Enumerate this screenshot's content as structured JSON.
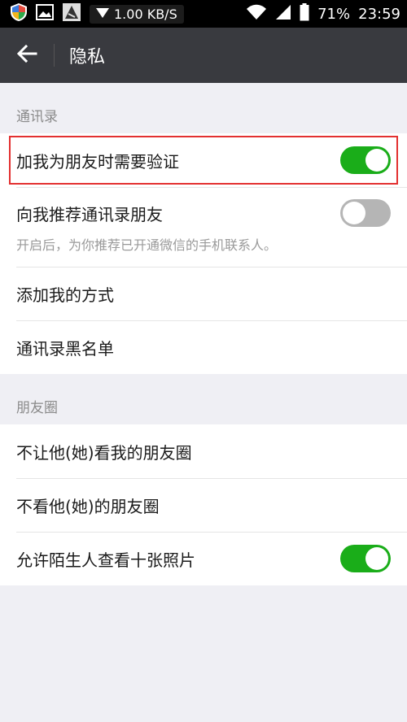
{
  "status_bar": {
    "speed": "1.00 KB/S",
    "battery": "71%",
    "time": "23:59"
  },
  "app_bar": {
    "title": "隐私"
  },
  "sections": [
    {
      "header": "通讯录",
      "items": [
        {
          "label": "加我为朋友时需要验证",
          "toggle": true,
          "highlighted": true
        },
        {
          "label": "向我推荐通讯录朋友",
          "toggle": false,
          "description": "开启后，为你推荐已开通微信的手机联系人。"
        },
        {
          "label": "添加我的方式"
        },
        {
          "label": "通讯录黑名单"
        }
      ]
    },
    {
      "header": "朋友圈",
      "items": [
        {
          "label": "不让他(她)看我的朋友圈"
        },
        {
          "label": "不看他(她)的朋友圈"
        },
        {
          "label": "允许陌生人查看十张照片",
          "toggle": true
        }
      ]
    }
  ],
  "colors": {
    "app_bar": "#393a3f",
    "toggle_on": "#1aad19",
    "toggle_off": "#b5b5b5",
    "highlight": "#e33030"
  }
}
